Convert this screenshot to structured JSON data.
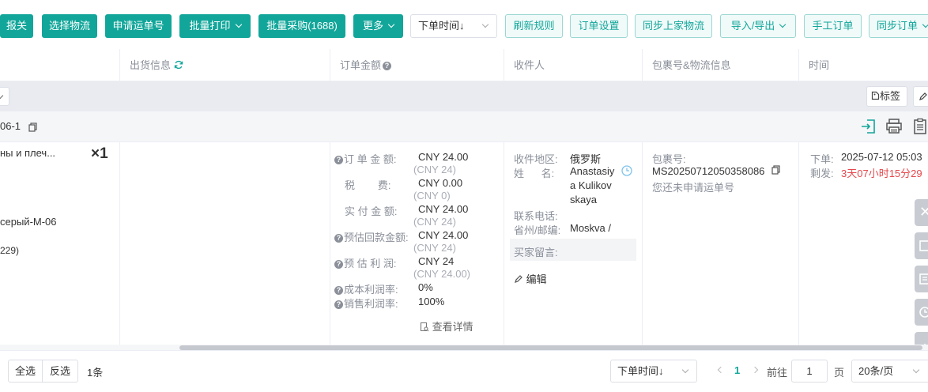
{
  "toolbar": {
    "btn_report": "报关",
    "btn_select_logistics": "选择物流",
    "btn_apply_tracking": "申请运单号",
    "btn_batch_print": "批量打印",
    "btn_batch_purchase": "批量采购(1688)",
    "btn_more": "更多",
    "sort_select": "下单时间↓",
    "btn_refresh_rules": "刷新规则",
    "btn_order_settings": "订单设置",
    "btn_sync_logistics": "同步上家物流",
    "btn_import_export": "导入/导出",
    "btn_manual_order": "手工订单",
    "btn_sync_orders": "同步订单"
  },
  "table": {
    "col_shipping": "出货信息",
    "col_amount": "订单金额",
    "col_recipient": "收件人",
    "col_package": "包裹号&物流信息",
    "col_time": "时间"
  },
  "group": {
    "tag_button": "标签"
  },
  "order": {
    "id_fragment": "06-1",
    "product_name": "ны и плеч...",
    "quantity": "×1",
    "sku": "серый-М-06",
    "sku_fragment": "229)",
    "amount": {
      "order_total_label": "订 单 金 额:",
      "order_total": "CNY 24.00",
      "order_total_sub": "(CNY 24)",
      "tax_label": "税        费:",
      "tax": "CNY 0.00",
      "tax_sub": "(CNY 0)",
      "paid_label": "实 付 金 额:",
      "paid": "CNY 24.00",
      "paid_sub": "(CNY 24)",
      "est_return_label": "预估回款金额:",
      "est_return": "CNY 24.00",
      "est_return_sub": "(CNY 24)",
      "est_profit_label": "预 估 利 润:",
      "est_profit": "CNY 24",
      "est_profit_sub": "(CNY 24.00)",
      "cost_margin_label": "成本利润率:",
      "cost_margin": "0%",
      "sales_margin_label": "销售利润率:",
      "sales_margin": "100%",
      "details_link": "查看详情"
    },
    "recipient": {
      "region_label": "收件地区:",
      "region": "俄罗斯",
      "name_label": "姓      名:",
      "name_l1": "Anastasiy",
      "name_l2": "a Kulikov",
      "name_l3": "skaya",
      "phone_label": "联系电话:",
      "province_label": "省州/邮编:",
      "province": "Moskva /",
      "buyer_note_label": "买家留言:",
      "edit_link": "编辑"
    },
    "package": {
      "label": "包裹号:",
      "number": "MS20250712050358086",
      "status": "您还未申请运单号"
    },
    "time": {
      "order_label": "下单:",
      "order_time": "2025-07-12 05:03",
      "remain_label": "剩发:",
      "remain": "3天07小时15分29"
    }
  },
  "footer": {
    "select_all": "全选",
    "invert": "反选",
    "count": "1条",
    "sort_select": "下单时间↓",
    "current_page": "1",
    "goto_label": "前往",
    "goto_value": "1",
    "page_unit": "页",
    "page_size": "20条/页"
  },
  "colors": {
    "accent": "#12a69a",
    "danger": "#e5484d"
  }
}
